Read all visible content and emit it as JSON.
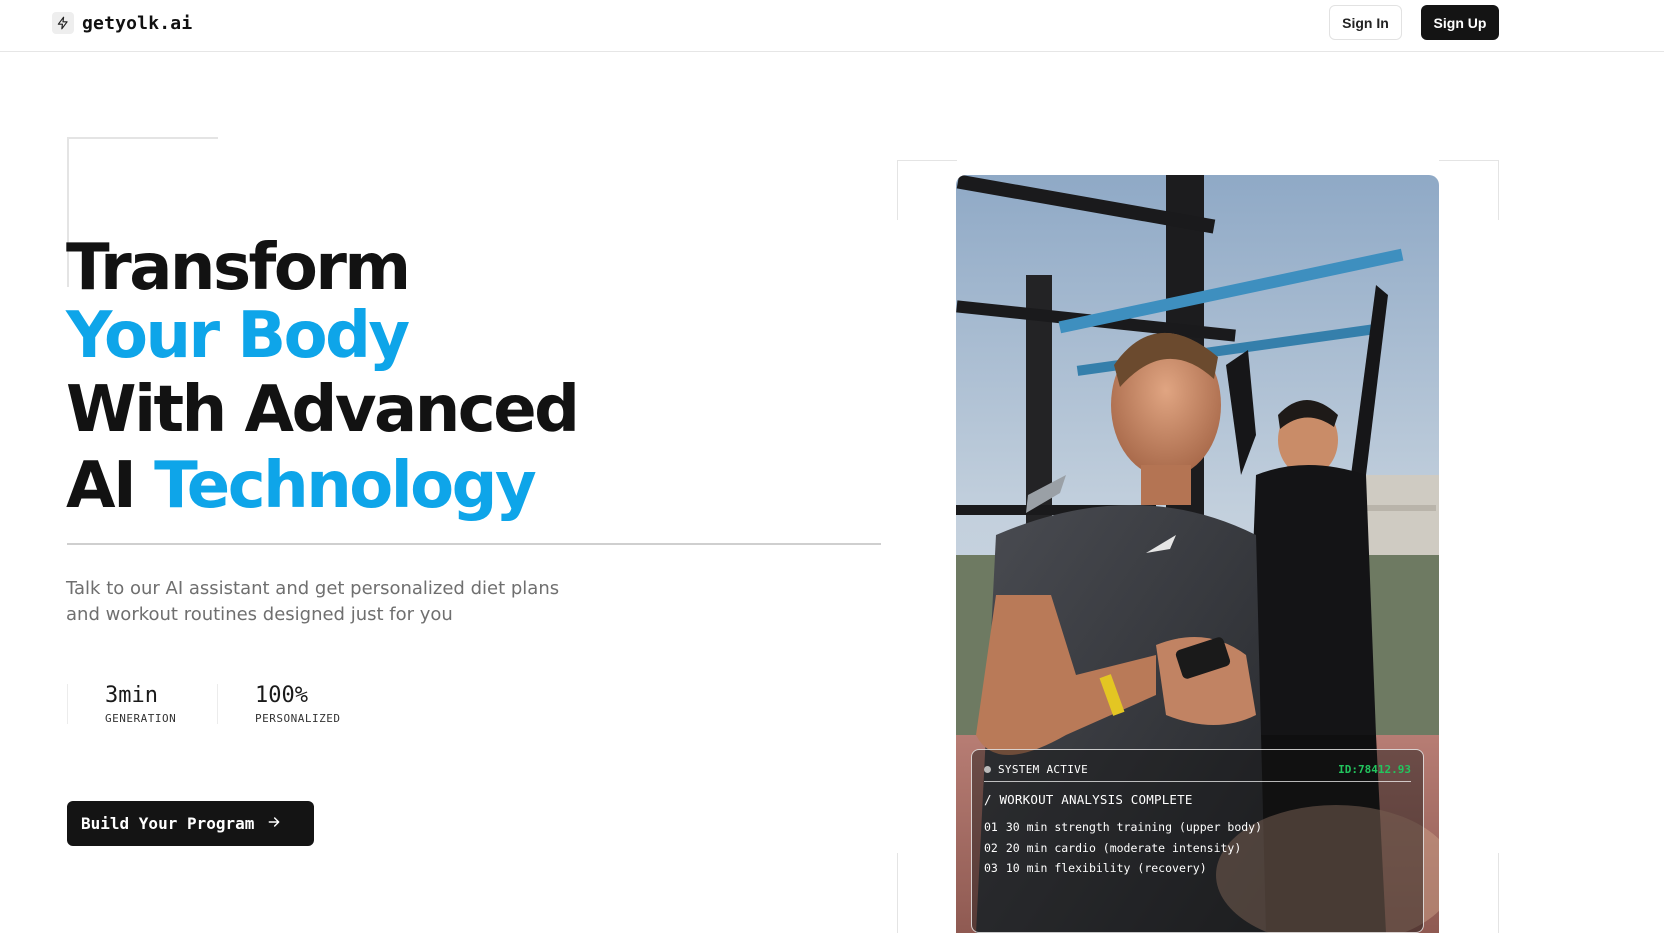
{
  "header": {
    "brand": "getyolk.ai",
    "brand_icon": "lightning-icon",
    "signin_label": "Sign In",
    "signup_label": "Sign Up"
  },
  "hero": {
    "headline": {
      "line1": "Transform",
      "line2": "Your Body",
      "line3": "With Advanced",
      "line4_prefix": "AI",
      "line4_highlight": "Technology"
    },
    "subtitle": "Talk to our AI assistant and get personalized diet plans and workout routines designed just for you",
    "stats": [
      {
        "value": "3min",
        "label": "GENERATION"
      },
      {
        "value": "100%",
        "label": "PERSONALIZED"
      }
    ],
    "cta_label": "Build Your Program",
    "cta_icon": "arrow-right-icon"
  },
  "panel": {
    "status": "SYSTEM ACTIVE",
    "id": "ID:78412.93",
    "title": "/ WORKOUT ANALYSIS COMPLETE",
    "items": [
      {
        "num": "01",
        "text": "30 min strength training (upper body)"
      },
      {
        "num": "02",
        "text": "20 min cardio (moderate intensity)"
      },
      {
        "num": "03",
        "text": "10 min flexibility (recovery)"
      }
    ]
  },
  "colors": {
    "accent": "#0ea5e9",
    "dark": "#141414",
    "status_green": "#22c55e"
  }
}
